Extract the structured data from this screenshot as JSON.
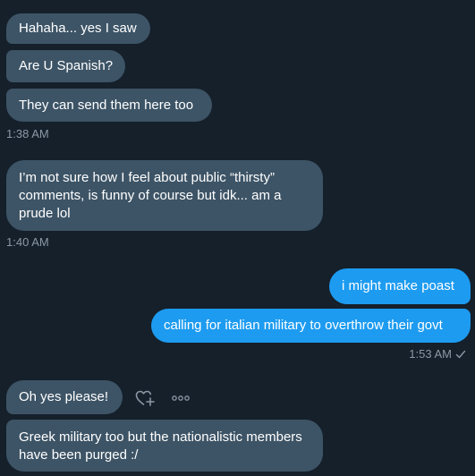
{
  "conversation": {
    "messages": [
      {
        "text": "Hahaha... yes I saw"
      },
      {
        "text": "Are U Spanish?"
      },
      {
        "text": "They can send them here too"
      },
      {
        "time": "1:38 AM"
      },
      {
        "text": "I’m not sure how I feel about public “thirsty” comments, is funny of course but idk... am a prude lol"
      },
      {
        "time": "1:40 AM"
      },
      {
        "text": "i might make poast"
      },
      {
        "text": "calling for italian military to overthrow their govt"
      },
      {
        "time": "1:53 AM"
      },
      {
        "text": "Oh yes please!"
      },
      {
        "text": "Greek military too but the nationalistic members have been purged :/"
      }
    ]
  },
  "icons": {
    "read_receipt": "check-icon",
    "react": "add-reaction-heart-icon",
    "more": "more-dots-icon"
  },
  "colors": {
    "background": "#15202b",
    "received_bubble": "#3d5466",
    "sent_bubble": "#1d9bf0",
    "timestamp": "#8b98a5"
  }
}
